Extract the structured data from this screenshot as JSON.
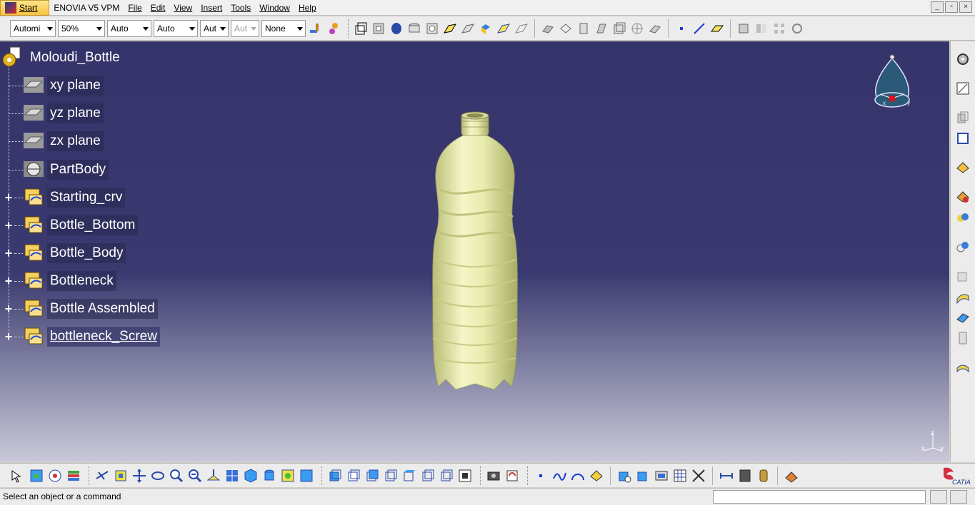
{
  "menu": {
    "start": "Start",
    "items": [
      {
        "label": "ENOVIA V5 VPM",
        "underline": false
      },
      {
        "label": "File"
      },
      {
        "label": "Edit"
      },
      {
        "label": "View"
      },
      {
        "label": "Insert"
      },
      {
        "label": "Tools"
      },
      {
        "label": "Window"
      },
      {
        "label": "Help"
      }
    ],
    "win_min": "_",
    "win_restore": "▫",
    "win_close": "×"
  },
  "toolbar_top": {
    "combo_automatic": "Automi",
    "combo_zoom": "50%",
    "combo_auto1": "Auto",
    "combo_auto2": "Auto",
    "combo_auto3": "Aut",
    "combo_auto4_disabled": "Aut",
    "combo_none": "None"
  },
  "tree": {
    "root": "Moloudi_Bottle",
    "nodes": [
      {
        "label": "xy plane",
        "icon": "plane-icon"
      },
      {
        "label": "yz plane",
        "icon": "plane-icon"
      },
      {
        "label": "zx plane",
        "icon": "plane-icon"
      },
      {
        "label": "PartBody",
        "icon": "body-icon"
      },
      {
        "label": "Starting_crv",
        "icon": "geometrical-set-icon"
      },
      {
        "label": "Bottle_Bottom",
        "icon": "geometrical-set-icon"
      },
      {
        "label": "Bottle_Body",
        "icon": "geometrical-set-icon"
      },
      {
        "label": "Bottleneck",
        "icon": "geometrical-set-icon"
      },
      {
        "label": "Bottle Assembled",
        "icon": "geometrical-set-icon"
      },
      {
        "label": "bottleneck_Screw",
        "icon": "geometrical-set-icon"
      }
    ]
  },
  "compass": {
    "x": "x",
    "y": "y",
    "z": "z"
  },
  "status": {
    "message": "Select an object or a command",
    "command_value": ""
  },
  "colors": {
    "viewport_top": "#35346a",
    "bottle": "#eef2b8",
    "menu_start": "#f7c33f"
  }
}
